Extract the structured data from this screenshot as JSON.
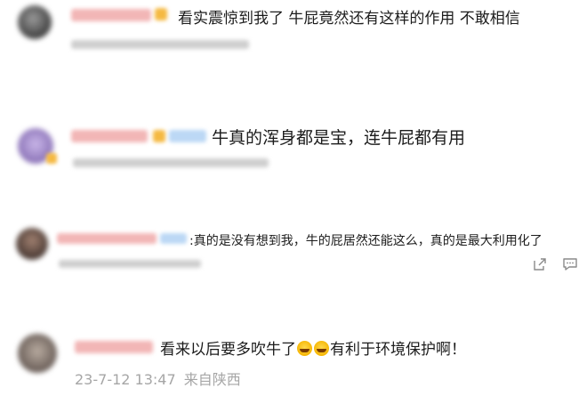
{
  "comments": [
    {
      "text": "看实震惊到我了 牛屁竟然还有这样的作用 不敢相信"
    },
    {
      "text": "牛真的浑身都是宝，连牛屁都有用"
    },
    {
      "text": ":真的是没有想到我，牛的屁居然还能这么，真的是最大利用化了",
      "share_icon": "share-icon",
      "comment_icon": "comment-icon"
    },
    {
      "text_part1": "看来以后要多吹牛了",
      "text_part2": "有利于环境保护啊！",
      "emoji": "laughing-tears-emoji",
      "timestamp": "23-7-12 13:47",
      "source": "来自陕西"
    }
  ]
}
